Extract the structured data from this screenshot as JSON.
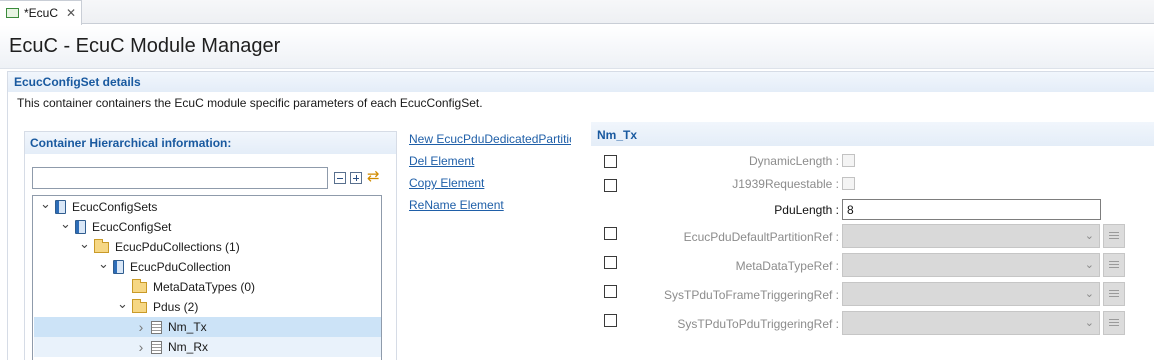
{
  "tab": {
    "label": "*EcuC",
    "close": "✕"
  },
  "page": {
    "title": "EcuC - EcuC Module Manager"
  },
  "section": {
    "title": "EcucConfigSet details",
    "description": "This container containers the EcuC module specific parameters of each EcucConfigSet."
  },
  "left_panel": {
    "title": "Container Hierarchical information:",
    "filter_value": "",
    "tree": [
      {
        "label": "EcucConfigSets",
        "icon": "module-icon",
        "state": "open"
      },
      {
        "label": "EcucConfigSet",
        "icon": "module-icon",
        "state": "open"
      },
      {
        "label": "EcucPduCollections (1)",
        "icon": "folder-icon",
        "state": "open"
      },
      {
        "label": "EcucPduCollection",
        "icon": "module-icon",
        "state": "open"
      },
      {
        "label": "MetaDataTypes (0)",
        "icon": "folder-icon",
        "state": "leaf"
      },
      {
        "label": "Pdus (2)",
        "icon": "folder-icon",
        "state": "open"
      },
      {
        "label": "Nm_Tx",
        "icon": "document-icon",
        "state": "closed",
        "selected": true
      },
      {
        "label": "Nm_Rx",
        "icon": "document-icon",
        "state": "closed"
      }
    ]
  },
  "actions": {
    "new": "New EcucPduDedicatedPartition",
    "del": "Del Element",
    "copy": "Copy Element",
    "rename": "ReName Element"
  },
  "form": {
    "title": "Nm_Tx",
    "fields": {
      "dynamic_length": "DynamicLength :",
      "j1939": "J1939Requestable :",
      "pdu_length": "PduLength :",
      "pdu_length_value": "8",
      "default_partition": "EcucPduDefaultPartitionRef :",
      "meta_data_type": "MetaDataTypeRef :",
      "frame_triggering": "SysTPduToFrameTriggeringRef :",
      "pdu_triggering": "SysTPduToPduTriggeringRef :"
    }
  },
  "colors": {
    "accent": "#19599f",
    "link": "#1f5fa8",
    "selection": "#cce3f7"
  }
}
